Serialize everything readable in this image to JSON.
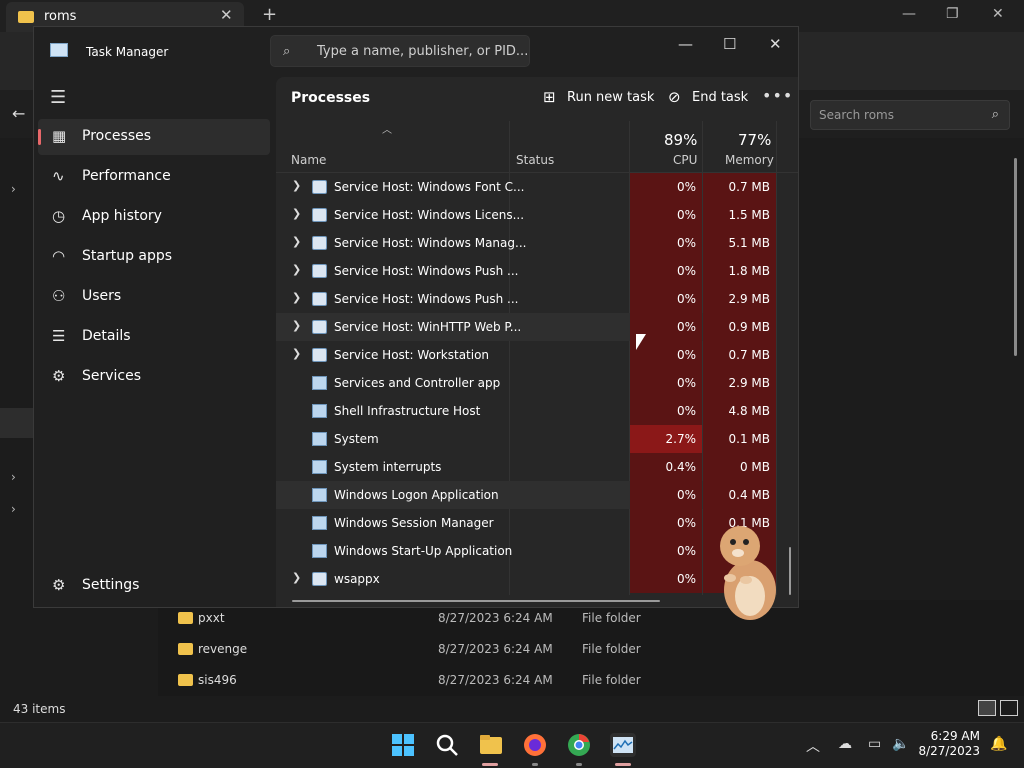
{
  "explorer": {
    "tab_title": "roms",
    "search_placeholder": "Search roms",
    "status_count": "43 items",
    "rows": [
      {
        "name": "pxxt",
        "date": "8/27/2023 6:24 AM",
        "type": "File folder"
      },
      {
        "name": "revenge",
        "date": "8/27/2023 6:24 AM",
        "type": "File folder"
      },
      {
        "name": "sis496",
        "date": "8/27/2023 6:24 AM",
        "type": "File folder"
      }
    ]
  },
  "taskmanager": {
    "app_title": "Task Manager",
    "search_placeholder": "Type a name, publisher, or PID...",
    "nav": [
      {
        "label": "Processes",
        "icon": "processes-icon"
      },
      {
        "label": "Performance",
        "icon": "performance-icon"
      },
      {
        "label": "App history",
        "icon": "app-history-icon"
      },
      {
        "label": "Startup apps",
        "icon": "startup-apps-icon"
      },
      {
        "label": "Users",
        "icon": "users-icon"
      },
      {
        "label": "Details",
        "icon": "details-icon"
      },
      {
        "label": "Services",
        "icon": "services-icon"
      }
    ],
    "settings_label": "Settings",
    "page_title": "Processes",
    "run_new_task": "Run new task",
    "end_task": "End task",
    "columns": {
      "name": "Name",
      "status": "Status",
      "cpu": "CPU",
      "memory": "Memory",
      "cpu_total": "89%",
      "mem_total": "77%"
    },
    "processes": [
      {
        "name": "Service Host: Windows Font C...",
        "cpu": "0%",
        "mem": "0.7 MB",
        "expandable": true,
        "icon": "gear"
      },
      {
        "name": "Service Host: Windows Licens...",
        "cpu": "0%",
        "mem": "1.5 MB",
        "expandable": true,
        "icon": "gear"
      },
      {
        "name": "Service Host: Windows Manag...",
        "cpu": "0%",
        "mem": "5.1 MB",
        "expandable": true,
        "icon": "gear"
      },
      {
        "name": "Service Host: Windows Push ...",
        "cpu": "0%",
        "mem": "1.8 MB",
        "expandable": true,
        "icon": "gear"
      },
      {
        "name": "Service Host: Windows Push ...",
        "cpu": "0%",
        "mem": "2.9 MB",
        "expandable": true,
        "icon": "gear"
      },
      {
        "name": "Service Host: WinHTTP Web P...",
        "cpu": "0%",
        "mem": "0.9 MB",
        "expandable": true,
        "icon": "gear"
      },
      {
        "name": "Service Host: Workstation",
        "cpu": "0%",
        "mem": "0.7 MB",
        "expandable": true,
        "icon": "gear"
      },
      {
        "name": "Services and Controller app",
        "cpu": "0%",
        "mem": "2.9 MB",
        "expandable": false,
        "icon": "app"
      },
      {
        "name": "Shell Infrastructure Host",
        "cpu": "0%",
        "mem": "4.8 MB",
        "expandable": false,
        "icon": "app"
      },
      {
        "name": "System",
        "cpu": "2.7%",
        "mem": "0.1 MB",
        "expandable": false,
        "icon": "app"
      },
      {
        "name": "System interrupts",
        "cpu": "0.4%",
        "mem": "0 MB",
        "expandable": false,
        "icon": "app"
      },
      {
        "name": "Windows Logon Application",
        "cpu": "0%",
        "mem": "0.4 MB",
        "expandable": false,
        "icon": "app"
      },
      {
        "name": "Windows Session Manager",
        "cpu": "0%",
        "mem": "0.1 MB",
        "expandable": false,
        "icon": "app"
      },
      {
        "name": "Windows Start-Up Application",
        "cpu": "0%",
        "mem": "",
        "expandable": false,
        "icon": "app"
      },
      {
        "name": "wsappx",
        "cpu": "0%",
        "mem": "",
        "expandable": true,
        "icon": "gear"
      }
    ]
  },
  "taskbar": {
    "time": "6:29 AM",
    "date": "8/27/2023"
  }
}
